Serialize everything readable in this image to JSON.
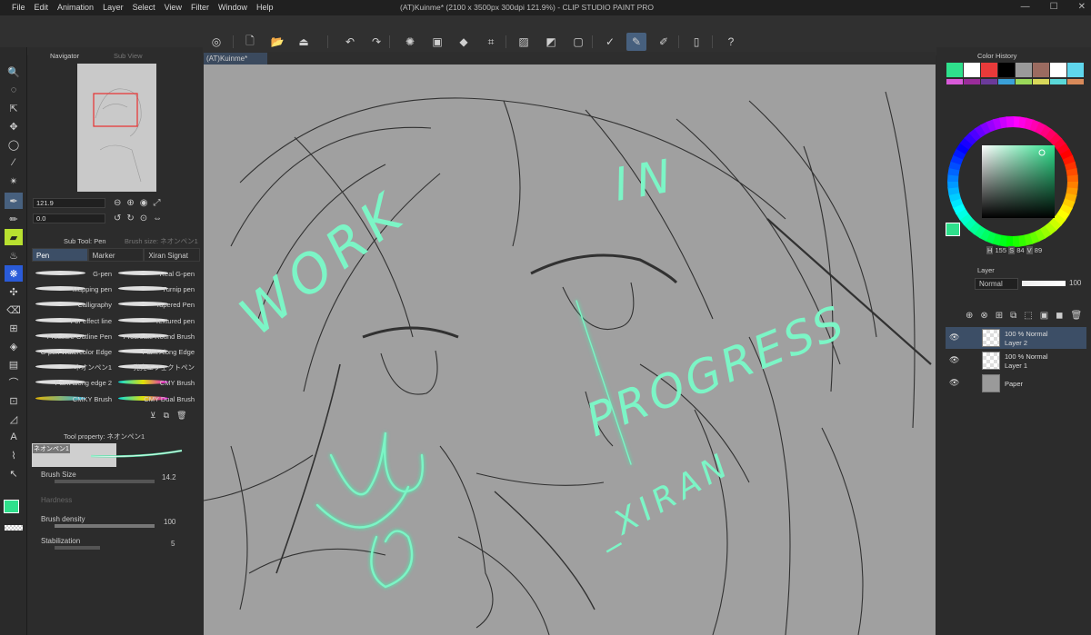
{
  "menu": [
    "File",
    "Edit",
    "Animation",
    "Layer",
    "Select",
    "View",
    "Filter",
    "Window",
    "Help"
  ],
  "window_title": "(AT)Kuinme* (2100 x 3500px 300dpi 121.9%)  - CLIP STUDIO PAINT PRO",
  "window_controls": {
    "minimize": "—",
    "maximize": "☐",
    "close": "✕"
  },
  "navigator": {
    "tab": "Navigator",
    "subtab": "Sub View",
    "zoom": "121.9",
    "angle": "0.0"
  },
  "subtool": {
    "tab": "Sub Tool: Pen",
    "brush_size_tab": "Brush size: ネオンペン1",
    "groups": [
      "Pen",
      "Marker",
      "Xiran Signat"
    ],
    "brushes": [
      [
        "G-pen",
        "Real G-pen"
      ],
      [
        "Mapping pen",
        "Turnip pen"
      ],
      [
        "Calligraphy",
        "Tapered Pen"
      ],
      [
        "For effect line",
        "Textured pen"
      ],
      [
        "Pressure Outline Pen",
        "Procreate Round Brush"
      ],
      [
        "G-pen Watercolor Edge",
        "Paint Along Edge"
      ],
      [
        "ネオンペン1",
        "発光エフェクトペン"
      ],
      [
        "Paint along edge 2",
        "CMY Brush"
      ],
      [
        "CMKY Brush",
        "CMY Dual Brush"
      ]
    ]
  },
  "tool_property": {
    "tab": "Tool property: ネオンペン1",
    "brush_name": "ネオンペン1",
    "brush_size_label": "Brush Size",
    "brush_size": "14.2",
    "hardness_label": "Hardness",
    "density_label": "Brush density",
    "density": "100",
    "stabilization_label": "Stabilization",
    "stabilization": "5"
  },
  "canvas_tab": "(AT)Kuinme*",
  "color_history": {
    "title": "Color History",
    "swatches": [
      "#2fe08c",
      "#ffffff",
      "#e83a3a",
      "#000000",
      "#9a9a9a",
      "#9b6b60",
      "#ffffff",
      "#5fd6ec"
    ],
    "row2": [
      "#d85ad8",
      "#9a2c9a",
      "#6b3a9a",
      "#3aa0d8",
      "#9ad85a",
      "#d8d85a",
      "#5ad8d8",
      "#d88a5a"
    ]
  },
  "color_wheel": {
    "h": "155",
    "s": "84",
    "v": "89",
    "h_label": "H",
    "s_label": "S",
    "v_label": "V",
    "main": "#2fe08c"
  },
  "layer_panel": {
    "tab": "Layer",
    "blend_mode": "Normal",
    "opacity": "100",
    "layers": [
      {
        "line1": "100 % Normal",
        "line2": "Layer 2",
        "selected": true
      },
      {
        "line1": "100 % Normal",
        "line2": "Layer 1",
        "selected": false
      },
      {
        "line1": "",
        "line2": "Paper",
        "selected": false
      }
    ]
  },
  "canvas_text": {
    "w1": "WORK",
    "w2": "IN",
    "w3": "PROGRESS",
    "sig": "_XIRAN"
  }
}
